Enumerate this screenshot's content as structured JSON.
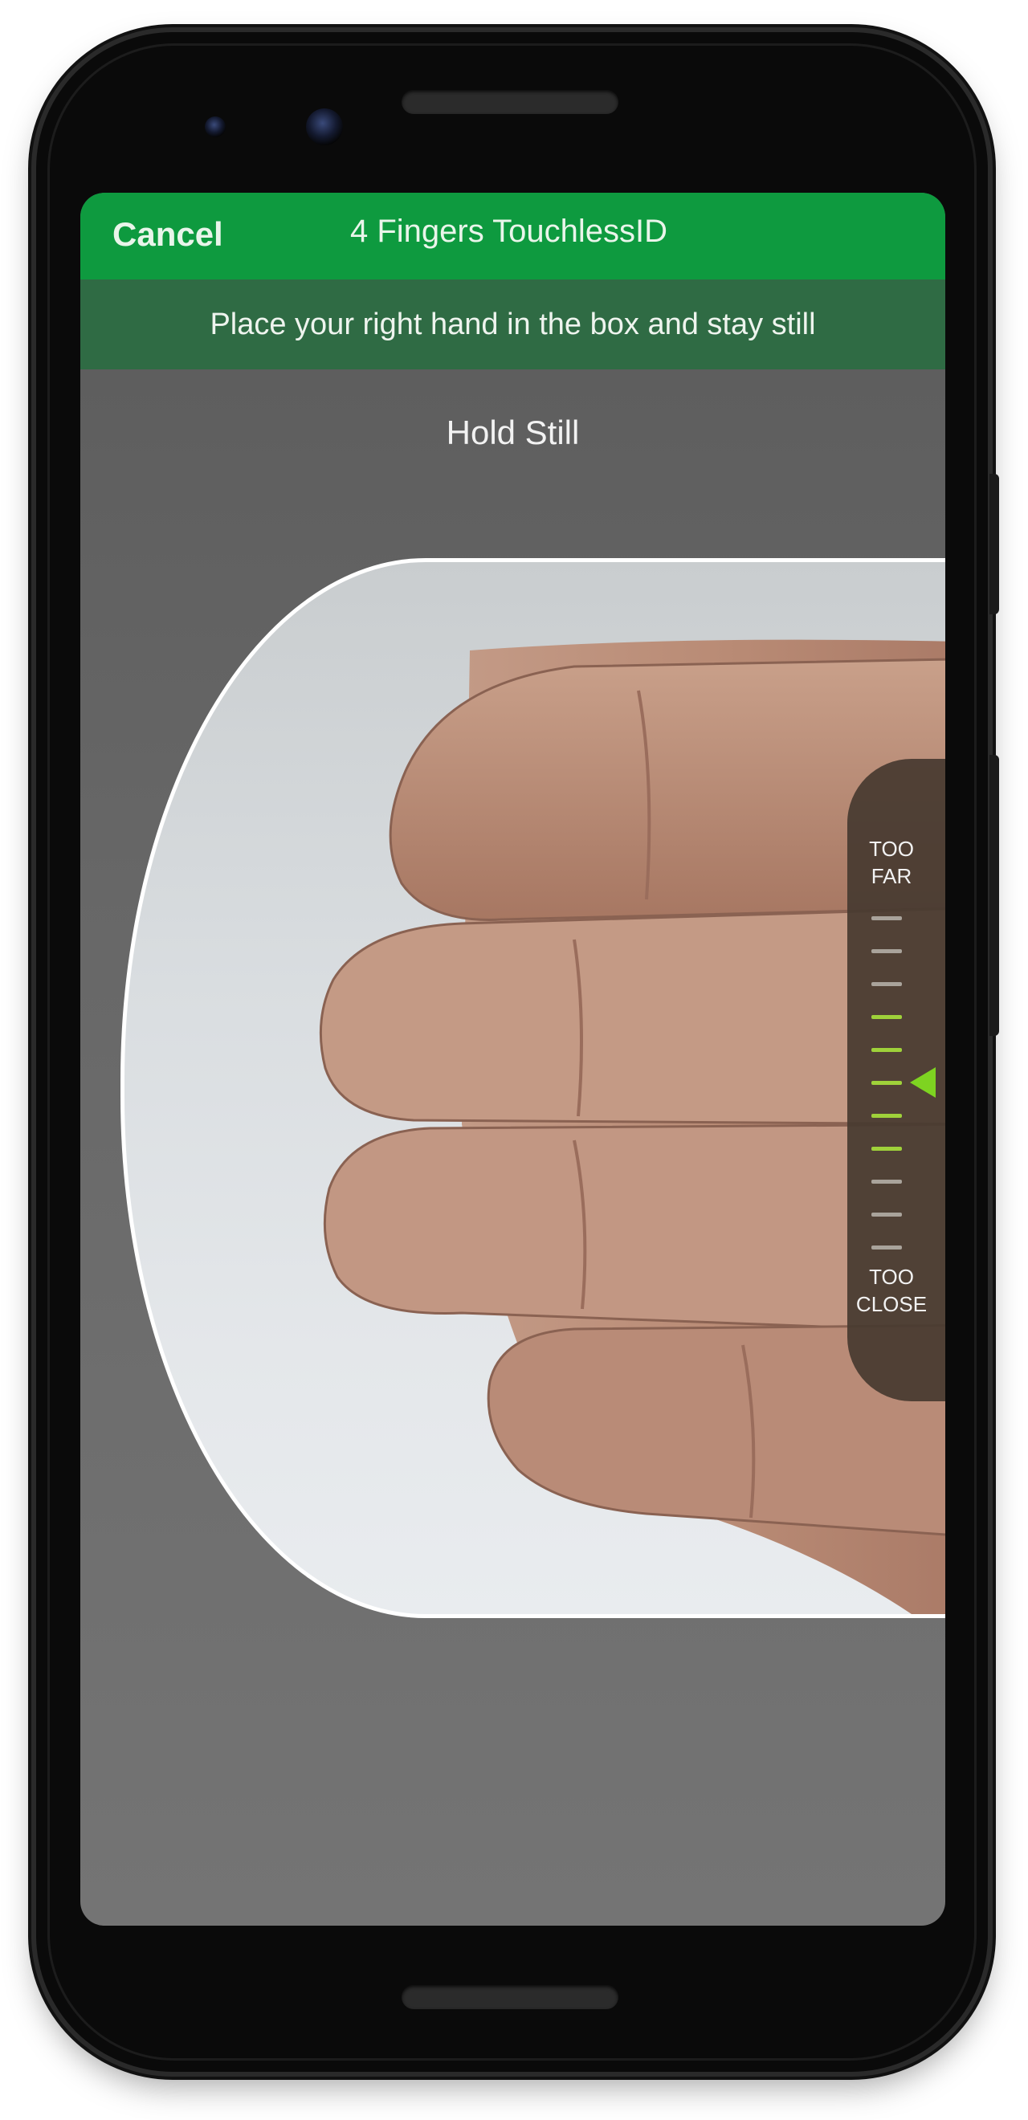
{
  "app_bar": {
    "cancel_label": "Cancel",
    "title": "4 Fingers TouchlessID",
    "color": "#0e9a3f"
  },
  "instruction": {
    "text": "Place your right hand in the box and stay still",
    "color": "#2f6b44"
  },
  "status": {
    "text": "Hold Still"
  },
  "distance_gauge": {
    "top_label": "TOO\nFAR",
    "bottom_label": "TOO\nCLOSE",
    "tick_count": 11,
    "active_ticks": [
      3,
      4,
      5,
      6,
      7
    ],
    "indicator_level": 0.5,
    "active_color": "#9fd13a",
    "inactive_color": "#a9a39b",
    "pointer_color": "#7ed321"
  },
  "camera_preview": {
    "subject": "right hand, four fingers"
  }
}
